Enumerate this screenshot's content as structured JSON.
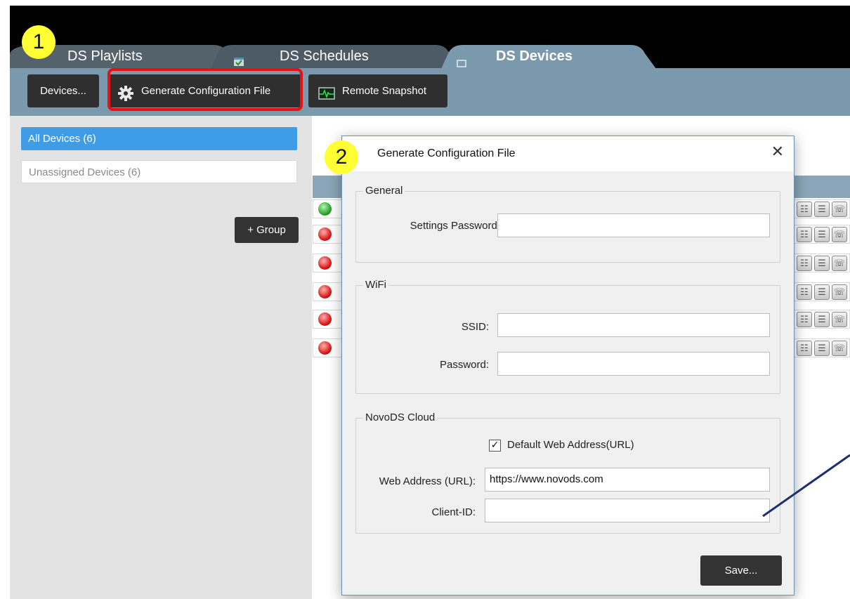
{
  "tabs": [
    {
      "label": "DS Playlists",
      "active": false
    },
    {
      "label": "DS Schedules",
      "active": false
    },
    {
      "label": "DS Devices",
      "active": true
    }
  ],
  "toolbar": {
    "devices_label": "Devices...",
    "generate_label": "Generate Configuration File",
    "snapshot_label": "Remote Snapshot"
  },
  "sidebar": {
    "items": [
      {
        "label": "All Devices (6)",
        "selected": true
      },
      {
        "label": "Unassigned Devices (6)",
        "selected": false
      }
    ],
    "group_button": "+ Group"
  },
  "device_rows": [
    {
      "status": "online"
    },
    {
      "status": "offline"
    },
    {
      "status": "offline"
    },
    {
      "status": "offline"
    },
    {
      "status": "offline"
    },
    {
      "status": "offline"
    }
  ],
  "dialog": {
    "title": "Generate Configuration File",
    "close_glyph": "✕",
    "general": {
      "legend": "General",
      "settings_password_label": "Settings Password:",
      "settings_password_value": ""
    },
    "wifi": {
      "legend": "WiFi",
      "ssid_label": "SSID:",
      "ssid_value": "",
      "password_label": "Password:",
      "password_value": ""
    },
    "cloud": {
      "legend": "NovoDS Cloud",
      "default_url_label": "Default Web Address(URL)",
      "default_url_checked": true,
      "web_address_label": "Web Address (URL):",
      "web_address_value": "https://www.novods.com",
      "client_id_label": "Client-ID:",
      "client_id_value": ""
    },
    "save_label": "Save..."
  },
  "markers": {
    "step1": "1",
    "step2": "2"
  },
  "colors": {
    "toolbar_bg": "#7b99ad",
    "selected_item": "#3f9de8",
    "highlight_border": "#e81010",
    "marker_fill": "#ffff33",
    "annotation_line": "#1f2f6b"
  }
}
